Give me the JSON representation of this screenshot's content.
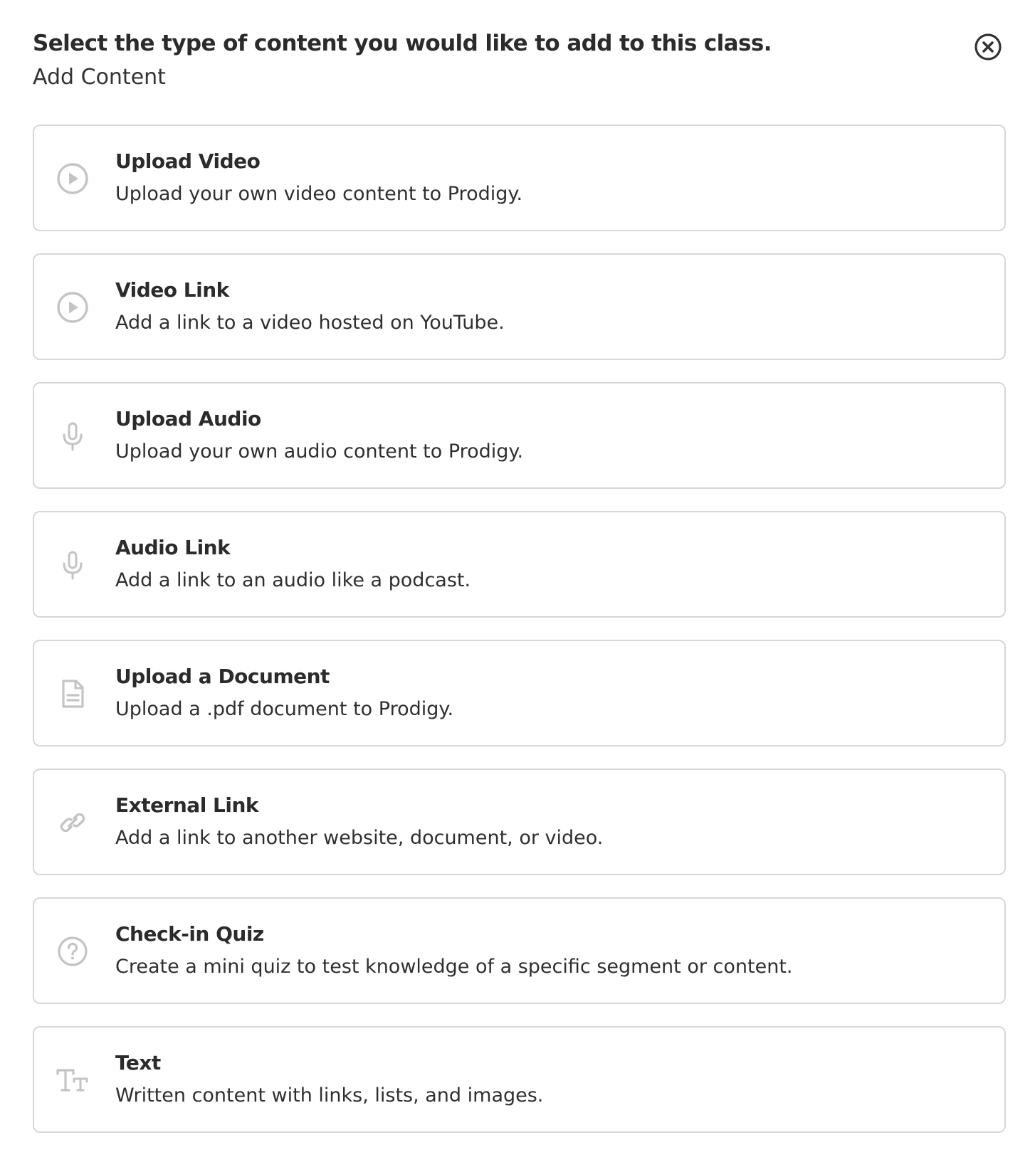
{
  "header": {
    "title": "Select the type of content you would like to add to this class.",
    "subtitle": "Add Content",
    "close_icon": "close-circle-icon"
  },
  "options": [
    {
      "title": "Upload Video",
      "description": "Upload your own video content to Prodigy.",
      "icon": "play-circle-icon"
    },
    {
      "title": "Video Link",
      "description": "Add a link to a video hosted on YouTube.",
      "icon": "play-circle-icon"
    },
    {
      "title": "Upload Audio",
      "description": "Upload your own audio content to Prodigy.",
      "icon": "microphone-icon"
    },
    {
      "title": "Audio Link",
      "description": "Add a link to an audio like a podcast.",
      "icon": "microphone-icon"
    },
    {
      "title": "Upload a Document",
      "description": "Upload a .pdf document to Prodigy.",
      "icon": "document-icon"
    },
    {
      "title": "External Link",
      "description": "Add a link to another website, document, or video.",
      "icon": "link-icon"
    },
    {
      "title": "Check-in Quiz",
      "description": "Create a mini quiz to test knowledge of a specific segment or content.",
      "icon": "question-circle-icon"
    },
    {
      "title": "Text",
      "description": "Written content with links, lists, and images.",
      "icon": "text-format-icon"
    }
  ],
  "colors": {
    "text": "#2b2b2b",
    "border": "#d7d7d7",
    "icon": "#c4c4c4",
    "close_icon": "#333333"
  }
}
